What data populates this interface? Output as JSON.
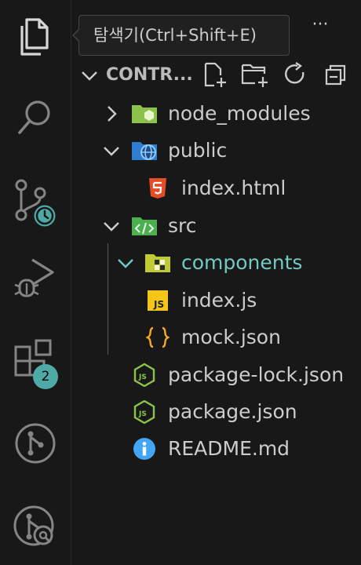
{
  "tooltip": {
    "text": "탐색기(Ctrl+Shift+E)"
  },
  "activity_bar": {
    "items": [
      {
        "name": "explorer",
        "icon": "files-icon"
      },
      {
        "name": "search",
        "icon": "search-icon"
      },
      {
        "name": "source-control",
        "icon": "source-control-icon"
      },
      {
        "name": "run-debug",
        "icon": "run-debug-icon"
      },
      {
        "name": "extensions",
        "icon": "extensions-icon",
        "badge": "2"
      },
      {
        "name": "git-graph",
        "icon": "git-branch-icon"
      },
      {
        "name": "gitlens",
        "icon": "gitlens-icon"
      }
    ]
  },
  "explorer": {
    "more_actions": "···",
    "section_title": "CONTR...",
    "tree": [
      {
        "label": "node_modules",
        "type": "folder",
        "expanded": false,
        "icon": "node-folder-icon"
      },
      {
        "label": "public",
        "type": "folder",
        "expanded": true,
        "icon": "public-folder-icon"
      },
      {
        "label": "index.html",
        "type": "file",
        "icon": "html5-icon"
      },
      {
        "label": "src",
        "type": "folder",
        "expanded": true,
        "icon": "src-folder-icon"
      },
      {
        "label": "components",
        "type": "folder",
        "expanded": true,
        "icon": "components-folder-icon"
      },
      {
        "label": "index.js",
        "type": "file",
        "icon": "js-icon"
      },
      {
        "label": "mock.json",
        "type": "file",
        "icon": "json-icon"
      },
      {
        "label": "package-lock.json",
        "type": "file",
        "icon": "nodejs-icon"
      },
      {
        "label": "package.json",
        "type": "file",
        "icon": "nodejs-icon"
      },
      {
        "label": "README.md",
        "type": "file",
        "icon": "info-icon"
      }
    ]
  },
  "colors": {
    "background": "#181818",
    "text": "#cccccc",
    "highlight": "#4daaa6",
    "components_text": "#73c9c3"
  }
}
